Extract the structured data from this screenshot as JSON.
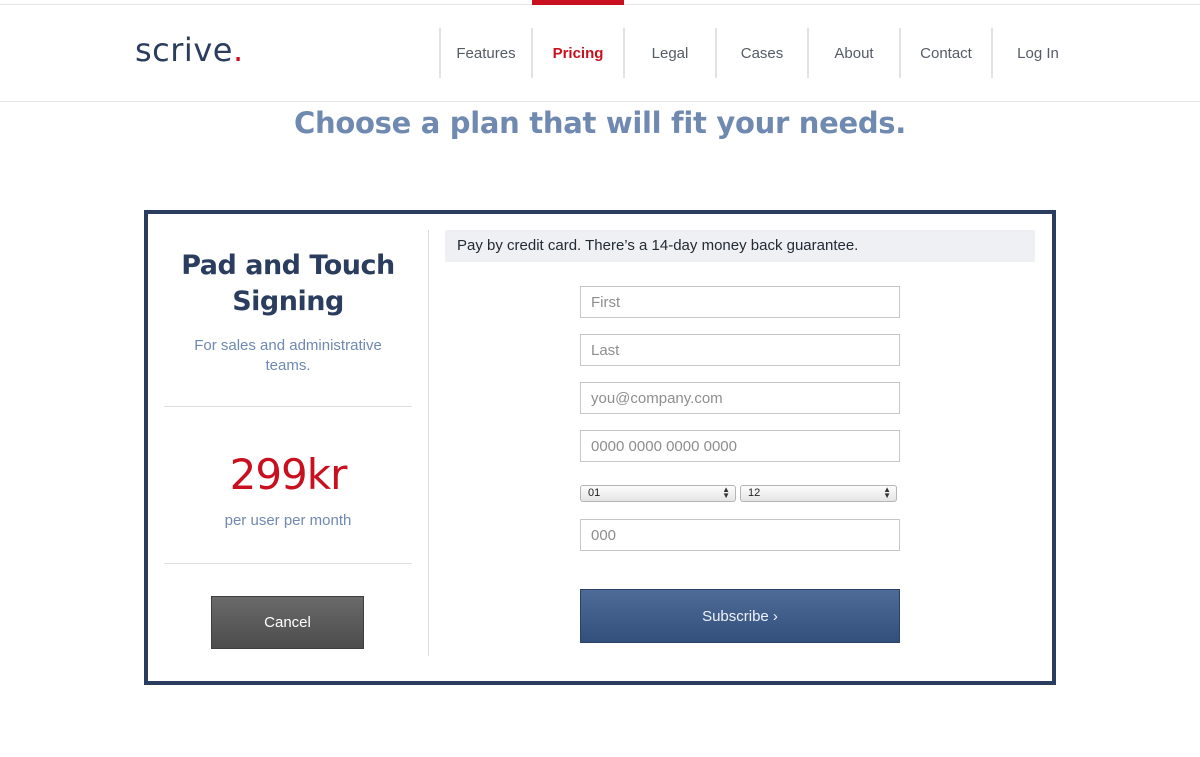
{
  "brand": {
    "name": "scrive",
    "dot": ".",
    "accent_color": "#c8101e",
    "primary_color": "#2a3d5e"
  },
  "nav": {
    "items": [
      {
        "label": "Features"
      },
      {
        "label": "Pricing",
        "active": true
      },
      {
        "label": "Legal"
      },
      {
        "label": "Cases"
      },
      {
        "label": "About"
      },
      {
        "label": "Contact"
      },
      {
        "label": "Log In"
      }
    ]
  },
  "headline": "Choose a plan that will fit your needs.",
  "plan": {
    "title": "Pad and Touch Signing",
    "subtitle": "For sales and administrative teams.",
    "price": "299kr",
    "price_unit": "per user per month",
    "cancel_label": "Cancel"
  },
  "payment": {
    "notice": "Pay by credit card. There’s a 14-day money back guarantee.",
    "first_name": {
      "value": "",
      "placeholder": "First"
    },
    "last_name": {
      "value": "",
      "placeholder": "Last"
    },
    "email": {
      "value": "",
      "placeholder": "you@company.com"
    },
    "card_number": {
      "value": "",
      "placeholder": "0000 0000 0000 0000"
    },
    "exp_month": {
      "selected": "01"
    },
    "exp_year": {
      "selected": "12"
    },
    "cvc": {
      "value": "",
      "placeholder": "000"
    },
    "subscribe_label": "Subscribe ›"
  }
}
